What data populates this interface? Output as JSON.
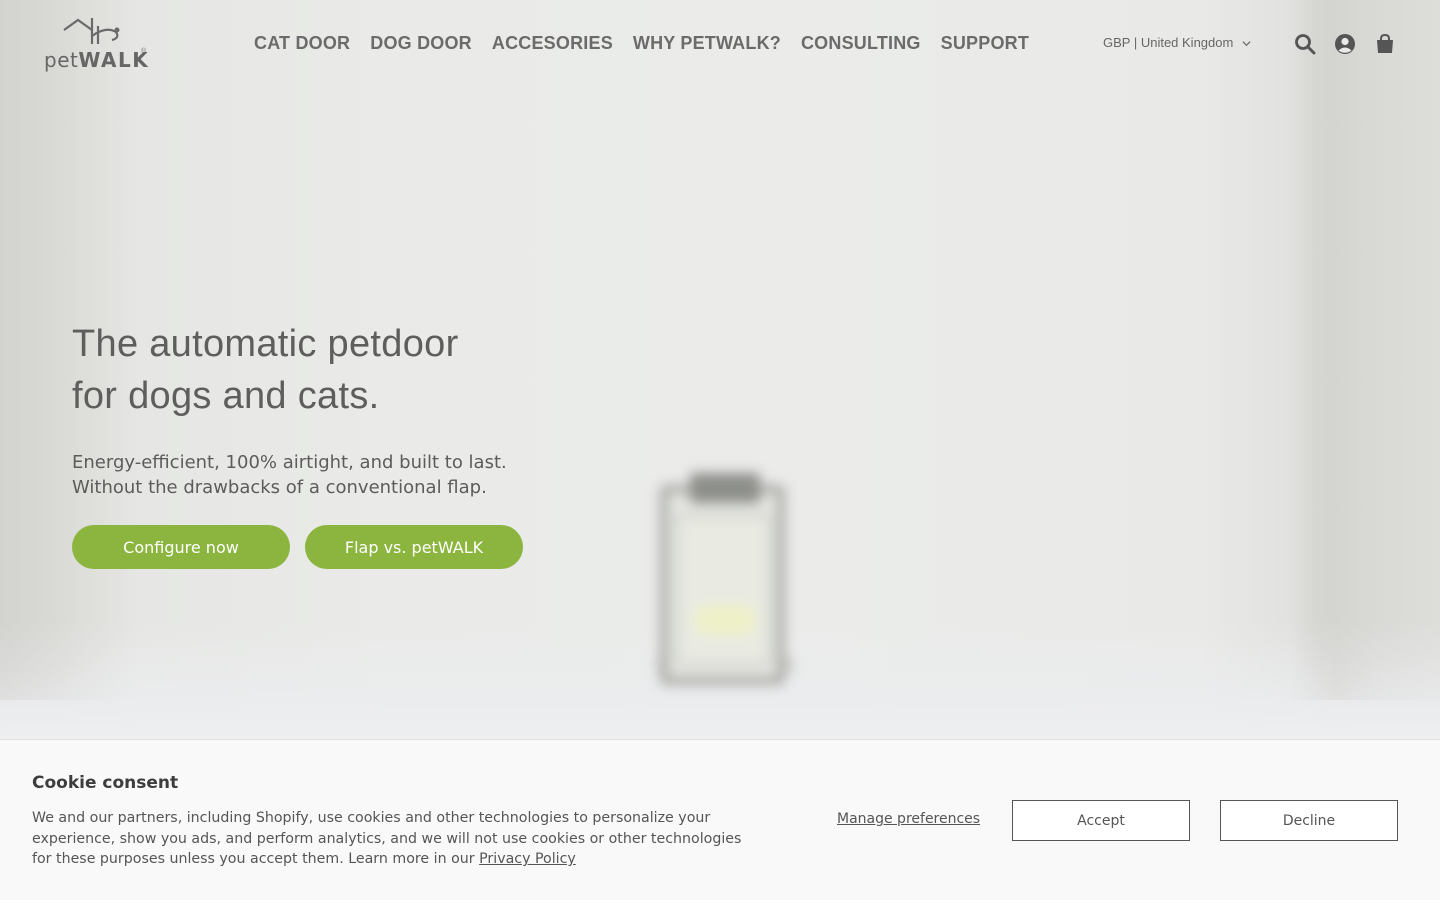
{
  "brand": {
    "logo_text_regular": "pet",
    "logo_text_bold": "WALK",
    "registered": "®"
  },
  "nav": {
    "items": [
      {
        "label": "CAT DOOR"
      },
      {
        "label": "DOG DOOR"
      },
      {
        "label": "ACCESORIES"
      },
      {
        "label": "WHY PETWALK?"
      },
      {
        "label": "CONSULTING"
      },
      {
        "label": "SUPPORT"
      }
    ]
  },
  "locale": {
    "label": "GBP | United Kingdom"
  },
  "header_icons": [
    "search-icon",
    "account-icon",
    "cart-icon"
  ],
  "hero": {
    "title_line1": "The automatic petdoor",
    "title_line2": "for dogs and cats.",
    "subtitle_line1": "Energy-efficient, 100% airtight, and built to last.",
    "subtitle_line2": "Without the drawbacks of a conventional flap.",
    "primary_button": "Configure now",
    "secondary_button": "Flap vs. petWALK"
  },
  "cookie": {
    "title": "Cookie consent",
    "text_line1": "We and our partners, including Shopify, use cookies and other technologies to personalize your",
    "text_line2": "experience, show you ads, and perform analytics, and we will not use cookies or other technologies",
    "text_line3": "for these purposes unless you accept them. Learn more in our ",
    "privacy_link": "Privacy Policy",
    "manage_label": "Manage preferences",
    "accept_label": "Accept",
    "decline_label": "Decline"
  },
  "colors": {
    "accent_green": "#8bb53f",
    "text_gray": "#5e5e5c",
    "banner_bg": "#f9f9f9"
  }
}
